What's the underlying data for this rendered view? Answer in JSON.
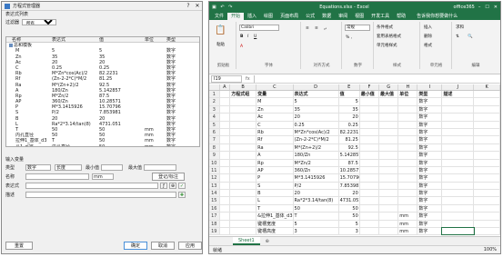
{
  "dialog": {
    "title": "方程式管理器",
    "win_buttons": [
      "?",
      "✕"
    ],
    "list_section_label": "表达式列表",
    "filter_label": "过滤器",
    "filter_value": "所有",
    "columns": [
      "名称",
      "表达式",
      "值",
      "单位",
      "类型"
    ],
    "root_group": "总和模板",
    "rows": [
      {
        "name": "M",
        "expr": "5",
        "val": "5",
        "unit": "",
        "type": "数字"
      },
      {
        "name": "Zn",
        "expr": "35",
        "val": "35",
        "unit": "",
        "type": "数字"
      },
      {
        "name": "Ac",
        "expr": "20",
        "val": "20",
        "unit": "",
        "type": "数字"
      },
      {
        "name": "C",
        "expr": "0.25",
        "val": "0.25",
        "unit": "",
        "type": "数字"
      },
      {
        "name": "Rb",
        "expr": "M*Zn*cos(Ac)/2",
        "val": "82.2231",
        "unit": "",
        "type": "数字"
      },
      {
        "name": "Rf",
        "expr": "(Zn-2-2*C)*M/2",
        "val": "81.25",
        "unit": "",
        "type": "数字"
      },
      {
        "name": "Ra",
        "expr": "M*(Zn+2)/2",
        "val": "92.5",
        "unit": "",
        "type": "数字"
      },
      {
        "name": "A",
        "expr": "180/Zn",
        "val": "5.142857",
        "unit": "",
        "type": "数字"
      },
      {
        "name": "Rp",
        "expr": "M*Zn/2",
        "val": "87.5",
        "unit": "",
        "type": "数字"
      },
      {
        "name": "AP",
        "expr": "360/Zn",
        "val": "10.28571",
        "unit": "",
        "type": "数字"
      },
      {
        "name": "P",
        "expr": "M*3.1415926",
        "val": "15.70796",
        "unit": "",
        "type": "数字"
      },
      {
        "name": "S",
        "expr": "P/2",
        "val": "7.853981",
        "unit": "",
        "type": "数字"
      },
      {
        "name": "B",
        "expr": "20",
        "val": "20",
        "unit": "",
        "type": "数字"
      },
      {
        "name": "L",
        "expr": "Ra*2*3.14/tan(8)",
        "val": "4731.051",
        "unit": "",
        "type": "数字"
      },
      {
        "name": "T",
        "expr": "50",
        "val": "50",
        "unit": "mm",
        "type": "数字"
      },
      {
        "name": "内孔直径",
        "expr": "50",
        "val": "50",
        "unit": "mm",
        "type": "数字"
      },
      {
        "name": "拉伸1_基体_d3",
        "expr": "T",
        "val": "50",
        "unit": "mm",
        "type": "数字"
      },
      {
        "name": "孔1_d25",
        "expr": "内孔直径",
        "val": "50",
        "unit": "mm",
        "type": "数字"
      }
    ],
    "input_section_label": "输入变量",
    "type_label": "类型",
    "type_value": "数字",
    "length_value": "长度",
    "min_label": "最小值",
    "max_label": "最大值",
    "name_label": "名称",
    "unit_value": "mm",
    "register_label": "登记/标注",
    "expr_label": "表达式",
    "desc_label": "描述",
    "btn_reset": "重置",
    "btn_ok": "确定",
    "btn_cancel": "取消",
    "btn_apply": "应用"
  },
  "excel": {
    "title_file": "Equations.xlsx - Excel",
    "account": "office365",
    "tabs": [
      "文件",
      "开始",
      "插入",
      "绘图",
      "页面布局",
      "公式",
      "数据",
      "审阅",
      "视图",
      "开发工具",
      "帮助"
    ],
    "active_tab": 1,
    "search_hint": "告诉我你想要做什么",
    "ribbon_groups": [
      "剪贴板",
      "字体",
      "对齐方式",
      "数字",
      "样式",
      "单元格",
      "编辑"
    ],
    "ribbon_items": [
      "粘贴",
      "Calibri",
      "常规",
      "条件格式",
      "套用表格格式",
      "单元格样式",
      "插入",
      "删除",
      "格式",
      "求和"
    ],
    "name_box": "I19",
    "fx": "fx",
    "columns": [
      "A",
      "B",
      "C",
      "D",
      "E",
      "F",
      "G",
      "H",
      "I",
      "J",
      "K"
    ],
    "header_row": [
      "方程式组",
      "变量",
      "表达式",
      "值",
      "最小值",
      "最大值",
      "单位",
      "类型",
      "描述"
    ],
    "rows": [
      [
        "",
        "M",
        "5",
        "5",
        "",
        "",
        "",
        "数字",
        ""
      ],
      [
        "",
        "Zn",
        "35",
        "35",
        "",
        "",
        "",
        "数字",
        ""
      ],
      [
        "",
        "Ac",
        "20",
        "20",
        "",
        "",
        "",
        "数字",
        ""
      ],
      [
        "",
        "C",
        "0.25",
        "0.25",
        "",
        "",
        "",
        "数字",
        ""
      ],
      [
        "",
        "Rb",
        "M*Zn*cos(Ac)/2",
        "82.2231",
        "",
        "",
        "",
        "数字",
        ""
      ],
      [
        "",
        "Rf",
        "(Zn-2-2*C)*M/2",
        "81.25",
        "",
        "",
        "",
        "数字",
        ""
      ],
      [
        "",
        "Ra",
        "M*(Zn+2)/2",
        "92.5",
        "",
        "",
        "",
        "数字",
        ""
      ],
      [
        "",
        "A",
        "180/Zn",
        "5.142857",
        "",
        "",
        "",
        "数字",
        ""
      ],
      [
        "",
        "Rp",
        "M*Zn/2",
        "87.5",
        "",
        "",
        "",
        "数字",
        ""
      ],
      [
        "",
        "AP",
        "360/Zn",
        "10.28571",
        "",
        "",
        "",
        "数字",
        ""
      ],
      [
        "",
        "P",
        "M*3.1415926",
        "15.70796",
        "",
        "",
        "",
        "数字",
        ""
      ],
      [
        "",
        "S",
        "P/2",
        "7.853981",
        "",
        "",
        "",
        "数字",
        ""
      ],
      [
        "",
        "B",
        "20",
        "20",
        "",
        "",
        "",
        "数字",
        ""
      ],
      [
        "",
        "L",
        "Ra*2*3.14/tan(8)",
        "4731.051",
        "",
        "",
        "",
        "数字",
        ""
      ],
      [
        "",
        "T",
        "50",
        "50",
        "",
        "",
        "",
        "数字",
        ""
      ],
      [
        "",
        "&拉伸1_基体_d3",
        "T",
        "50",
        "",
        "",
        "mm",
        "数字",
        ""
      ],
      [
        "",
        "键槽宽度",
        "5",
        "5",
        "",
        "",
        "mm",
        "数字",
        ""
      ],
      [
        "",
        "键槽高度",
        "3",
        "3",
        "",
        "",
        "mm",
        "数字",
        ""
      ]
    ],
    "sheet_tab": "Sheet1",
    "status_left": "就绪",
    "zoom": "100%"
  }
}
